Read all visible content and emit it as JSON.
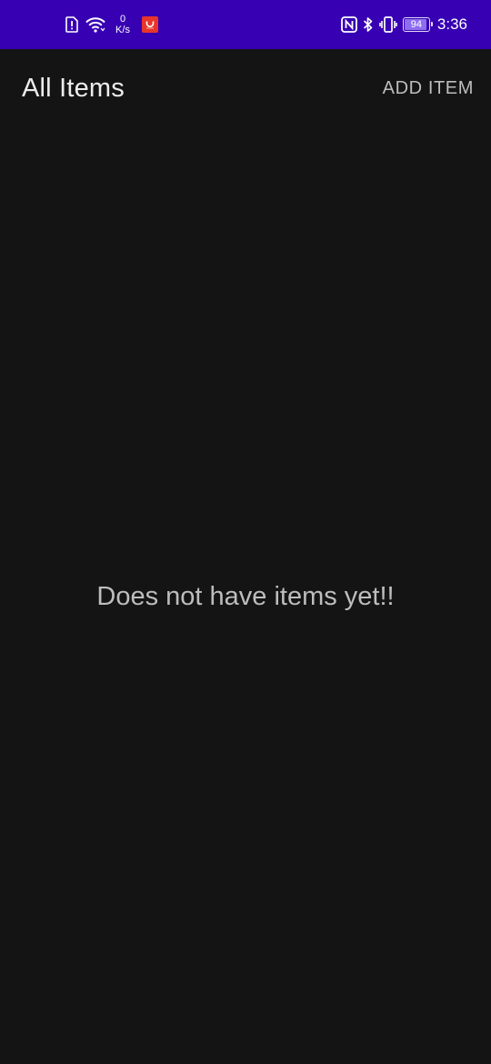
{
  "status_bar": {
    "background": "#3700b3",
    "icons_left": [
      "alert-icon",
      "wifi-icon",
      "network-speed",
      "app-notification-icon"
    ],
    "net_speed_value": "0",
    "net_speed_unit": "K/s",
    "icons_right": [
      "nfc-icon",
      "bluetooth-icon",
      "vibrate-icon",
      "battery-icon"
    ],
    "battery_level": "94",
    "battery_fraction": 0.94,
    "time": "3:36"
  },
  "app_bar": {
    "title": "All Items",
    "action_label": "ADD ITEM"
  },
  "main": {
    "empty_message": "Does not have items yet!!"
  },
  "colors": {
    "background": "#141414",
    "title_text": "#ececec",
    "secondary_text": "#bdbdbd"
  }
}
